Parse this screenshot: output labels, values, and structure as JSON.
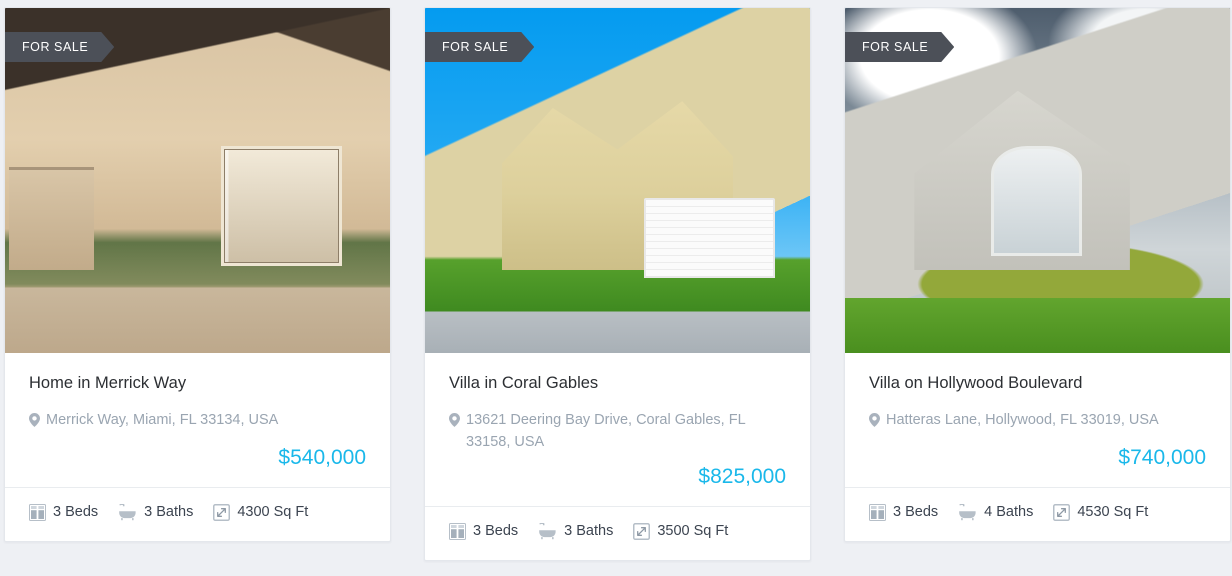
{
  "page": {
    "background_color": "#eef0f4",
    "accent_color": "#1ab8ea",
    "badge_color": "#4c5058",
    "card_background": "#ffffff"
  },
  "listings": [
    {
      "status_badge": "FOR SALE",
      "title": "Home in Merrick Way",
      "address": "Merrick Way, Miami, FL 33134, USA",
      "price": "$540,000",
      "features": {
        "beds": "3 Beds",
        "baths": "3 Baths",
        "area": "4300 Sq Ft"
      },
      "icons": {
        "location": "map-pin-icon",
        "beds": "bed-icon",
        "baths": "bathtub-icon",
        "area": "area-expand-icon"
      }
    },
    {
      "status_badge": "FOR SALE",
      "title": "Villa in Coral Gables",
      "address": "13621 Deering Bay Drive, Coral Gables, FL 33158, USA",
      "price": "$825,000",
      "features": {
        "beds": "3 Beds",
        "baths": "3 Baths",
        "area": "3500 Sq Ft"
      },
      "icons": {
        "location": "map-pin-icon",
        "beds": "bed-icon",
        "baths": "bathtub-icon",
        "area": "area-expand-icon"
      }
    },
    {
      "status_badge": "FOR SALE",
      "title": "Villa on Hollywood Boulevard",
      "address": "Hatteras Lane, Hollywood, FL 33019, USA",
      "price": "$740,000",
      "features": {
        "beds": "3 Beds",
        "baths": "4 Baths",
        "area": "4530 Sq Ft"
      },
      "icons": {
        "location": "map-pin-icon",
        "beds": "bed-icon",
        "baths": "bathtub-icon",
        "area": "area-expand-icon"
      }
    }
  ]
}
